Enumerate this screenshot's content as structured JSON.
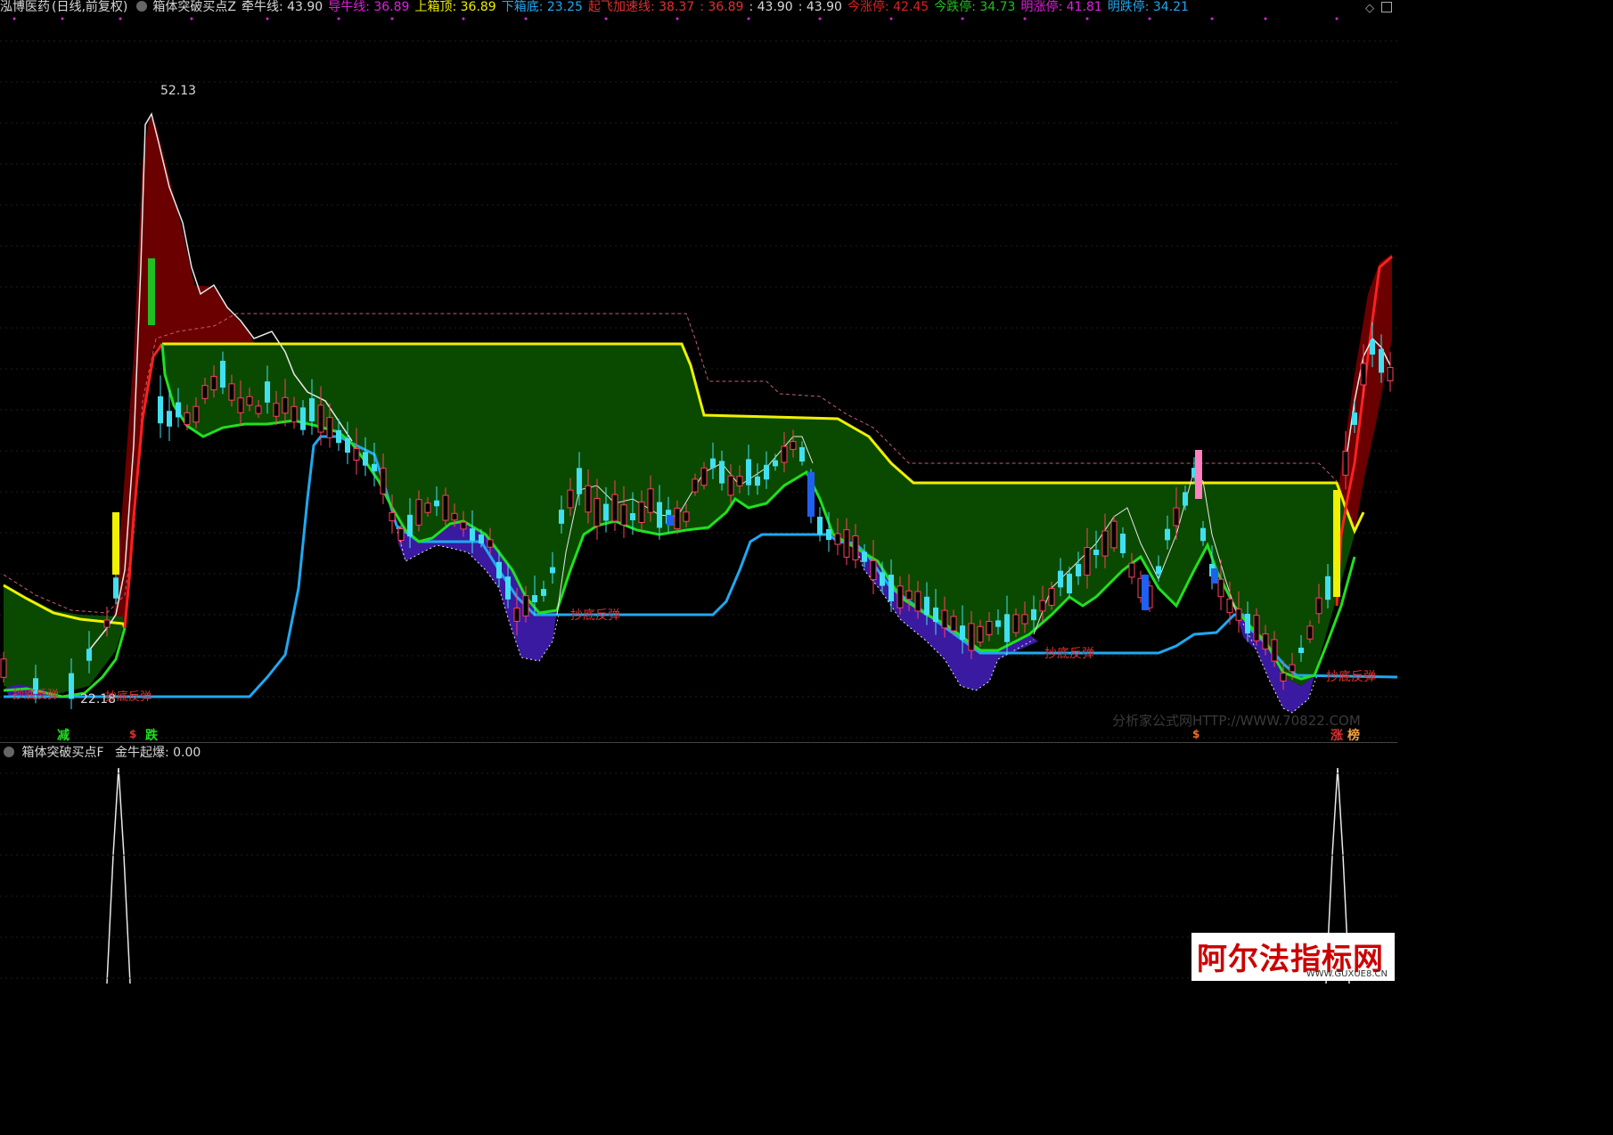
{
  "header": {
    "stock": "泓博医药",
    "period": "(日线,前复权)",
    "indicator": "箱体突破买点Z",
    "items": [
      {
        "label": "牵牛线:",
        "value": "43.90",
        "color": "#d8d8d8"
      },
      {
        "label": "导牛线:",
        "value": "36.89",
        "color": "#e020e0"
      },
      {
        "label": "上箱顶:",
        "value": "36.89",
        "color": "#f0f000"
      },
      {
        "label": "下箱底:",
        "value": "23.25",
        "color": "#20a8f0"
      },
      {
        "label": "起飞加速线:",
        "value": "38.37",
        "color": "#e03030"
      },
      {
        "label": ":",
        "value": "36.89",
        "color": "#e03030"
      },
      {
        "label": ":",
        "value": "43.90",
        "color": "#d8d8d8"
      },
      {
        "label": ":",
        "value": "43.90",
        "color": "#d8d8d8"
      },
      {
        "label": "今涨停:",
        "value": "42.45",
        "color": "#e02020"
      },
      {
        "label": "今跌停:",
        "value": "34.73",
        "color": "#20c020"
      },
      {
        "label": "明涨停:",
        "value": "41.81",
        "color": "#e020e0"
      },
      {
        "label": "明跌停:",
        "value": "34.21",
        "color": "#20a8f0"
      }
    ]
  },
  "price_labels": {
    "high": "52.13",
    "low": "22.18"
  },
  "signals": {
    "jian": "减",
    "die": "跌",
    "zhang": "涨",
    "bang": "榜",
    "dollar": "$",
    "chaodi": "抄底反弹"
  },
  "sub_header": {
    "indicator": "箱体突破买点F",
    "label": "金牛起爆:",
    "value": "0.00"
  },
  "watermark_site": "分析家公式网HTTP://WWW.70822.COM",
  "badge": {
    "title": "阿尔法指标网",
    "url": "WWW.GUXUE8.CN"
  },
  "colors": {
    "up": "#ff4060",
    "down": "#40e0f0",
    "box_fill": "#0a4a00",
    "red_fill": "#6a0000",
    "purple_fill": "#3a1aa0",
    "yellow": "#f0f000",
    "green": "#20e020",
    "blue": "#20a8f0",
    "white": "#e8e8e8",
    "dash": "#c06070"
  },
  "chart_data": {
    "type": "candlestick",
    "title": "泓博医药 日线 前复权",
    "ylim": [
      22.18,
      52.13
    ],
    "series": [
      {
        "name": "牵牛线",
        "values": [
          43.9
        ]
      },
      {
        "name": "导牛线",
        "values": [
          36.89
        ]
      },
      {
        "name": "上箱顶",
        "values": [
          36.89
        ]
      },
      {
        "name": "下箱底",
        "values": [
          23.25
        ]
      },
      {
        "name": "起飞加速线",
        "values": [
          38.37
        ]
      },
      {
        "name": "今涨停",
        "values": [
          42.45
        ]
      },
      {
        "name": "今跌停",
        "values": [
          34.73
        ]
      },
      {
        "name": "明涨停",
        "values": [
          41.81
        ]
      },
      {
        "name": "明跌停",
        "values": [
          34.21
        ]
      }
    ],
    "sub_series": [
      {
        "name": "金牛起爆",
        "values": [
          0.0
        ]
      }
    ]
  }
}
